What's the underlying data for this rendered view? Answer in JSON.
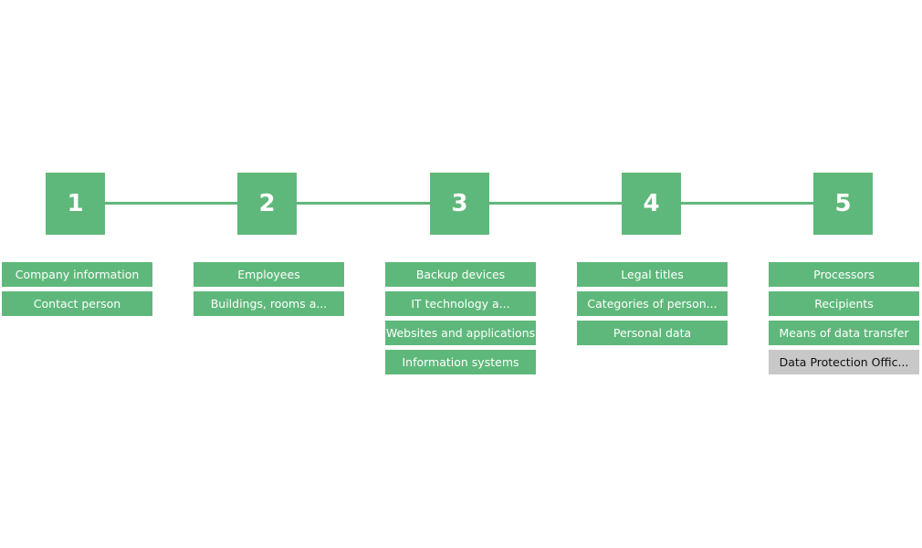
{
  "colors": {
    "active": "#5fb87b",
    "inactive": "#c8c8c8"
  },
  "steps": [
    {
      "number": "1",
      "items": [
        {
          "label": "Company information",
          "state": "active"
        },
        {
          "label": "Contact person",
          "state": "active"
        }
      ]
    },
    {
      "number": "2",
      "items": [
        {
          "label": "Employees",
          "state": "active"
        },
        {
          "label": "Buildings, rooms a...",
          "state": "active"
        }
      ]
    },
    {
      "number": "3",
      "items": [
        {
          "label": "Backup devices",
          "state": "active"
        },
        {
          "label": "IT technology a...",
          "state": "active"
        },
        {
          "label": "Websites and applications",
          "state": "active"
        },
        {
          "label": "Information systems",
          "state": "active"
        }
      ]
    },
    {
      "number": "4",
      "items": [
        {
          "label": "Legal titles",
          "state": "active"
        },
        {
          "label": "Categories of person...",
          "state": "active"
        },
        {
          "label": "Personal data",
          "state": "active"
        }
      ]
    },
    {
      "number": "5",
      "items": [
        {
          "label": "Processors",
          "state": "active"
        },
        {
          "label": "Recipients",
          "state": "active"
        },
        {
          "label": "Means of data transfer",
          "state": "active"
        },
        {
          "label": "Data Protection Offic...",
          "state": "inactive"
        }
      ]
    }
  ]
}
